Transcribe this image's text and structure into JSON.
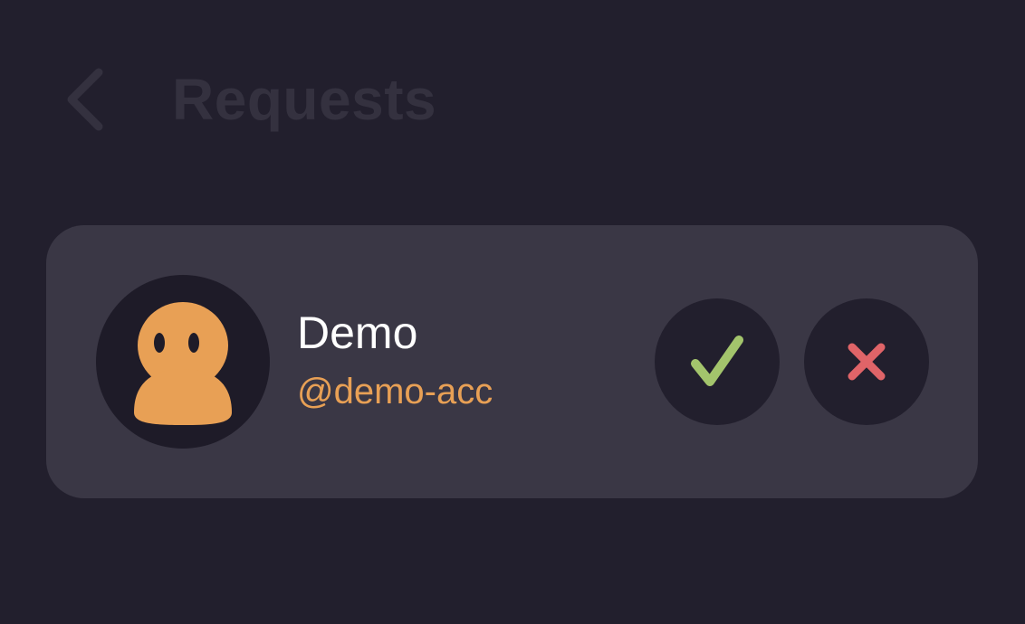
{
  "header": {
    "title": "Requests",
    "back_icon": "chevron-left-icon"
  },
  "request": {
    "display_name": "Demo",
    "username": "@demo-acc",
    "avatar_icon": "ghost-avatar-icon",
    "accept_icon": "check-icon",
    "decline_icon": "close-icon"
  },
  "colors": {
    "background": "#221f2d",
    "card": "#3a3745",
    "title_muted": "#34313f",
    "accent_orange": "#e8a055",
    "accept_green": "#a3c46c",
    "decline_red": "#e06468"
  }
}
